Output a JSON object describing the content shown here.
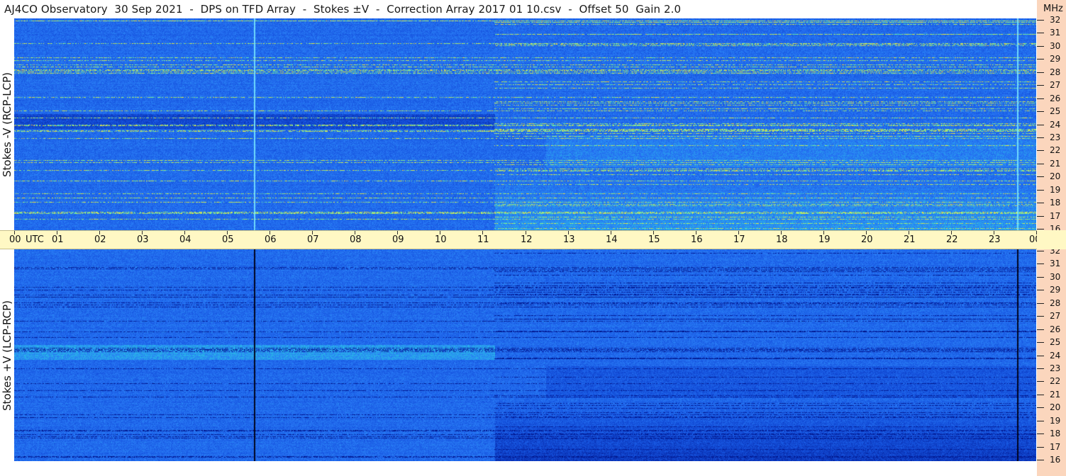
{
  "title": "AJ4CO Observatory  30 Sep 2021  -  DPS on TFD Array  -  Stokes ±V  -  Correction Array 2017 01 10.csv  -  Offset 50  Gain 2.0",
  "panels": {
    "top": {
      "label": "Stokes -V (RCP-LCP)",
      "mode": "bright"
    },
    "bottom": {
      "label": "Stokes +V (LCP-RCP)",
      "mode": "dark"
    }
  },
  "time_axis": {
    "utc_label": "UTC",
    "mhz_label": "MHz",
    "hours": [
      "00",
      "01",
      "02",
      "03",
      "04",
      "05",
      "06",
      "07",
      "08",
      "09",
      "10",
      "11",
      "12",
      "13",
      "14",
      "15",
      "16",
      "17",
      "18",
      "19",
      "20",
      "21",
      "22",
      "23",
      "00"
    ]
  },
  "frequency_axis": {
    "labels": [
      "32",
      "31",
      "30",
      "29",
      "28",
      "27",
      "26",
      "25",
      "24",
      "23",
      "22",
      "21",
      "20",
      "19",
      "18",
      "17",
      "16"
    ]
  },
  "colors": {
    "background_blue": "#2f64e0",
    "axis_yellow": "#fff8c4",
    "axis_peach": "#fbd6bd"
  }
}
